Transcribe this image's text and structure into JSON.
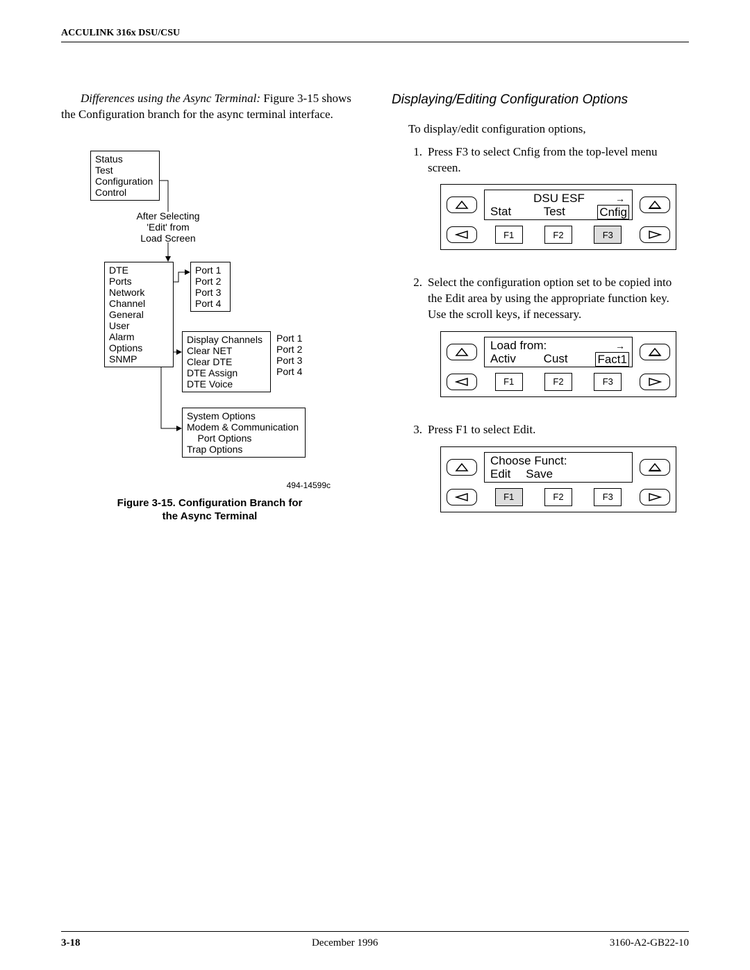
{
  "header": {
    "title": "ACCULINK 316x DSU/CSU"
  },
  "left": {
    "intro_runin": "Differences using the Async Terminal:",
    "intro_rest": " Figure 3-15 shows the Configuration branch for the async terminal interface.",
    "diagram": {
      "root_items": [
        "Status",
        "Test",
        "Configuration",
        "Control"
      ],
      "after_text": [
        "After Selecting",
        "'Edit' from",
        "Load Screen"
      ],
      "level2_items": [
        "DTE",
        "Ports",
        "Network",
        "Channel",
        "General",
        "User",
        "Alarm Options",
        "SNMP"
      ],
      "ports_items": [
        "Port 1",
        "Port 2",
        "Port 3",
        "Port 4"
      ],
      "channel_items": [
        "Display Channels",
        "Clear NET",
        "Clear DTE",
        "DTE Assign",
        "DTE Voice"
      ],
      "channel_ports": [
        "Port 1",
        "Port 2",
        "Port 3",
        "Port 4"
      ],
      "snmp_items": [
        "System Options",
        "Modem & Communication",
        "    Port Options",
        "Trap Options"
      ],
      "credit": "494-14599c"
    },
    "caption_line1": "Figure 3-15.  Configuration Branch for",
    "caption_line2": "the Async Terminal"
  },
  "right": {
    "heading": "Displaying/Editing Configuration Options",
    "intro": "To display/edit configuration options,",
    "steps": [
      {
        "num": "1.",
        "text": "Press F3 to select Cnfig from the top-level menu screen.",
        "lcd": {
          "top": "DSU ESF",
          "arrow": "→",
          "items": [
            "Stat",
            "Test",
            "Cnfig"
          ],
          "highlight_last": true,
          "active_f": "F3"
        }
      },
      {
        "num": "2.",
        "text": "Select the configuration option set to be copied into the Edit area by using the appropriate function key. Use the scroll keys, if necessary.",
        "lcd": {
          "top": "Load from:",
          "top_align": "left",
          "arrow": "→",
          "items": [
            "Activ",
            "Cust",
            "Fact1"
          ],
          "highlight_last": true,
          "active_f": ""
        }
      },
      {
        "num": "3.",
        "text": "Press F1 to select Edit.",
        "lcd": {
          "top": "Choose Funct:",
          "top_align": "left",
          "arrow": "",
          "items": [
            "Edit",
            "Save",
            ""
          ],
          "highlight_last": false,
          "active_f": "F1"
        }
      }
    ],
    "fkeys": [
      "F1",
      "F2",
      "F3"
    ]
  },
  "footer": {
    "page": "3-18",
    "center": "December 1996",
    "right": "3160-A2-GB22-10"
  }
}
